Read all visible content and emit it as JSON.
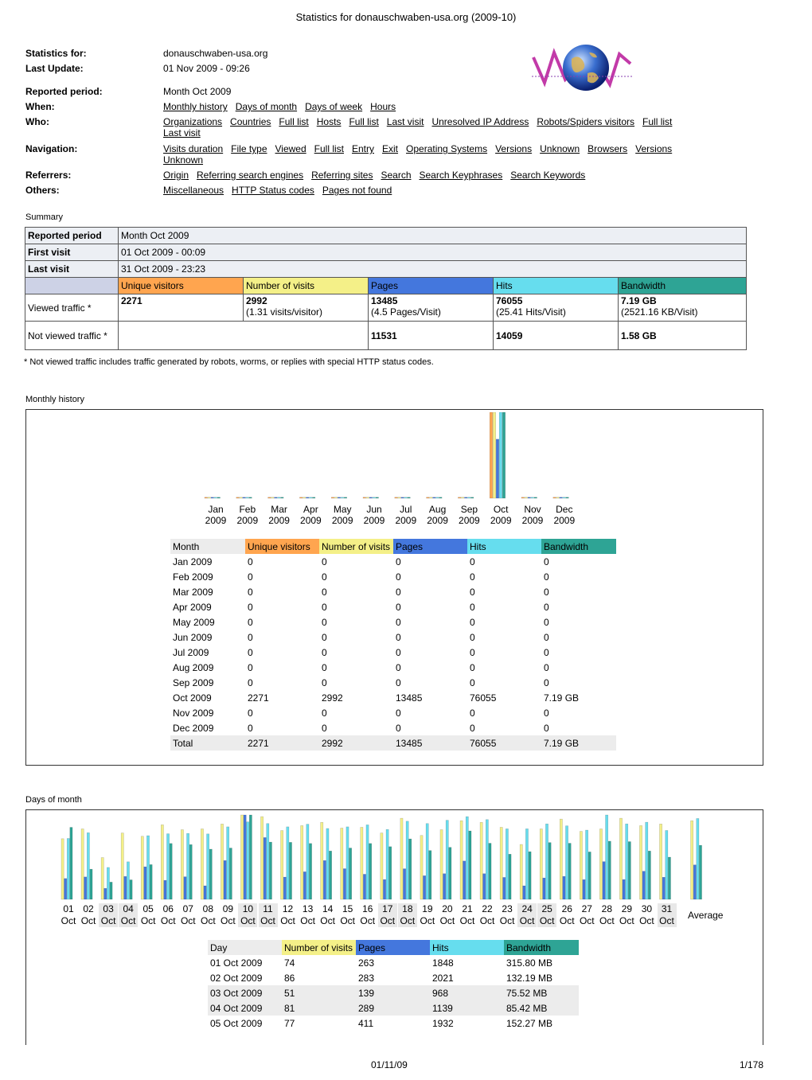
{
  "header": {
    "title": "Statistics for donauschwaben-usa.org (2009-10)"
  },
  "info": {
    "stats_for_label": "Statistics for:",
    "stats_for_value": "donauschwaben-usa.org",
    "last_update_label": "Last Update:",
    "last_update_value": "01 Nov 2009 - 09:26",
    "reported_label": "Reported period:",
    "reported_value": "Month Oct 2009",
    "when_label": "When:",
    "who_label": "Who:",
    "nav_label": "Navigation:",
    "ref_label": "Referrers:",
    "others_label": "Others:"
  },
  "links": {
    "when": [
      "Monthly history",
      "Days of month",
      "Days of week",
      "Hours"
    ],
    "who": [
      "Organizations",
      "Countries",
      "Full list",
      "Hosts",
      "Full list",
      "Last visit",
      "Unresolved IP Address",
      "Robots/Spiders visitors",
      "Full list",
      "Last visit"
    ],
    "nav": [
      "Visits duration",
      "File type",
      "Viewed",
      "Full list",
      "Entry",
      "Exit",
      "Operating Systems",
      "Versions",
      "Unknown",
      "Browsers",
      "Versions",
      "Unknown"
    ],
    "ref": [
      "Origin",
      "Referring search engines",
      "Referring sites",
      "Search",
      "Search Keyphrases",
      "Search Keywords"
    ],
    "others": [
      "Miscellaneous",
      "HTTP Status codes",
      "Pages not found"
    ]
  },
  "summary": {
    "section": "Summary",
    "reported_period_label": "Reported period",
    "reported_period_value": "Month Oct 2009",
    "first_visit_label": "First visit",
    "first_visit_value": "01 Oct 2009 - 00:09",
    "last_visit_label": "Last visit",
    "last_visit_value": "31 Oct 2009 - 23:23",
    "col_uv": "Unique visitors",
    "col_nv": "Number of visits",
    "col_pg": "Pages",
    "col_ht": "Hits",
    "col_bw": "Bandwidth",
    "viewed_label": "Viewed traffic *",
    "v_uv": "2271",
    "v_nv": "2992",
    "v_nv_sub": "(1.31 visits/visitor)",
    "v_pg": "13485",
    "v_pg_sub": "(4.5 Pages/Visit)",
    "v_ht": "76055",
    "v_ht_sub": "(25.41 Hits/Visit)",
    "v_bw": "7.19 GB",
    "v_bw_sub": "(2521.16 KB/Visit)",
    "not_viewed_label": "Not viewed traffic *",
    "nv_pg": "11531",
    "nv_ht": "14059",
    "nv_bw": "1.58 GB",
    "note": "* Not viewed traffic includes traffic generated by robots, worms, or replies with special HTTP status codes."
  },
  "colors": {
    "uv": "#ffa54f",
    "nv": "#f4f088",
    "pg": "#4477dd",
    "ht": "#66ddee",
    "bw": "#2ea495"
  },
  "monthly": {
    "section": "Monthly history",
    "headers": [
      "Month",
      "Unique visitors",
      "Number of visits",
      "Pages",
      "Hits",
      "Bandwidth"
    ],
    "rows": [
      [
        "Jan 2009",
        "0",
        "0",
        "0",
        "0",
        "0"
      ],
      [
        "Feb 2009",
        "0",
        "0",
        "0",
        "0",
        "0"
      ],
      [
        "Mar 2009",
        "0",
        "0",
        "0",
        "0",
        "0"
      ],
      [
        "Apr 2009",
        "0",
        "0",
        "0",
        "0",
        "0"
      ],
      [
        "May 2009",
        "0",
        "0",
        "0",
        "0",
        "0"
      ],
      [
        "Jun 2009",
        "0",
        "0",
        "0",
        "0",
        "0"
      ],
      [
        "Jul 2009",
        "0",
        "0",
        "0",
        "0",
        "0"
      ],
      [
        "Aug 2009",
        "0",
        "0",
        "0",
        "0",
        "0"
      ],
      [
        "Sep 2009",
        "0",
        "0",
        "0",
        "0",
        "0"
      ],
      [
        "Oct 2009",
        "2271",
        "2992",
        "13485",
        "76055",
        "7.19 GB"
      ],
      [
        "Nov 2009",
        "0",
        "0",
        "0",
        "0",
        "0"
      ],
      [
        "Dec 2009",
        "0",
        "0",
        "0",
        "0",
        "0"
      ]
    ],
    "total": [
      "Total",
      "2271",
      "2992",
      "13485",
      "76055",
      "7.19 GB"
    ],
    "axis_months": [
      "Jan",
      "Feb",
      "Mar",
      "Apr",
      "May",
      "Jun",
      "Jul",
      "Aug",
      "Sep",
      "Oct",
      "Nov",
      "Dec"
    ],
    "axis_year": "2009"
  },
  "chart_data": [
    {
      "type": "bar",
      "categories": [
        "Jan 2009",
        "Feb 2009",
        "Mar 2009",
        "Apr 2009",
        "May 2009",
        "Jun 2009",
        "Jul 2009",
        "Aug 2009",
        "Sep 2009",
        "Oct 2009",
        "Nov 2009",
        "Dec 2009"
      ],
      "series": [
        {
          "name": "Unique visitors",
          "values": [
            0,
            0,
            0,
            0,
            0,
            0,
            0,
            0,
            0,
            2271,
            0,
            0
          ]
        },
        {
          "name": "Number of visits",
          "values": [
            0,
            0,
            0,
            0,
            0,
            0,
            0,
            0,
            0,
            2992,
            0,
            0
          ]
        },
        {
          "name": "Pages",
          "values": [
            0,
            0,
            0,
            0,
            0,
            0,
            0,
            0,
            0,
            13485,
            0,
            0
          ]
        },
        {
          "name": "Hits",
          "values": [
            0,
            0,
            0,
            0,
            0,
            0,
            0,
            0,
            0,
            76055,
            0,
            0
          ]
        },
        {
          "name": "Bandwidth",
          "values": [
            0,
            0,
            0,
            0,
            0,
            0,
            0,
            0,
            0,
            7.19,
            0,
            0
          ]
        }
      ]
    },
    {
      "type": "bar",
      "categories": [
        "01",
        "02",
        "03",
        "04",
        "05",
        "06",
        "07",
        "08",
        "09",
        "10",
        "11",
        "12",
        "13",
        "14",
        "15",
        "16",
        "17",
        "18",
        "19",
        "20",
        "21",
        "22",
        "23",
        "24",
        "25",
        "26",
        "27",
        "28",
        "29",
        "30",
        "31",
        "Average"
      ],
      "series": [
        {
          "name": "Number of visits",
          "values": [
            74,
            86,
            51,
            81,
            77,
            91,
            85,
            86,
            92,
            103,
            101,
            84,
            90,
            94,
            87,
            88,
            81,
            99,
            78,
            85,
            96,
            94,
            88,
            67,
            86,
            98,
            83,
            86,
            99,
            90,
            92,
            96
          ]
        },
        {
          "name": "Pages",
          "values": [
            263,
            283,
            139,
            289,
            411,
            240,
            285,
            171,
            490,
            1065,
            780,
            281,
            348,
            490,
            387,
            317,
            250,
            386,
            298,
            324,
            484,
            324,
            277,
            171,
            270,
            290,
            249,
            476,
            250,
            355,
            279,
            435
          ]
        },
        {
          "name": "Hits",
          "values": [
            1848,
            2021,
            968,
            1139,
            1932,
            1990,
            2000,
            1985,
            2200,
            2350,
            2300,
            2200,
            2280,
            2150,
            2200,
            2260,
            2120,
            2370,
            2300,
            2400,
            2510,
            2420,
            2140,
            2140,
            2290,
            2230,
            2100,
            2560,
            2290,
            2340,
            2090,
            2453
          ]
        },
        {
          "name": "Bandwidth",
          "values": [
            315.8,
            132.19,
            75.52,
            85.45,
            152.27,
            245,
            240,
            220,
            225,
            370,
            251,
            250,
            245,
            212,
            225,
            245,
            231,
            265,
            214,
            228,
            300,
            246,
            198,
            209,
            249,
            246,
            208,
            255,
            253,
            212,
            185,
            237
          ]
        }
      ]
    }
  ],
  "days": {
    "section": "Days of month",
    "labels": [
      "01",
      "02",
      "03",
      "04",
      "05",
      "06",
      "07",
      "08",
      "09",
      "10",
      "11",
      "12",
      "13",
      "14",
      "15",
      "16",
      "17",
      "18",
      "19",
      "20",
      "21",
      "22",
      "23",
      "24",
      "25",
      "26",
      "27",
      "28",
      "29",
      "30",
      "31"
    ],
    "weekend": [
      3,
      4,
      10,
      11,
      17,
      18,
      24,
      25,
      31
    ],
    "month_word": "Oct",
    "average_label": "Average",
    "headers": [
      "Day",
      "Number of visits",
      "Pages",
      "Hits",
      "Bandwidth"
    ],
    "rows": [
      [
        "01 Oct 2009",
        "74",
        "263",
        "1848",
        "315.80 MB"
      ],
      [
        "02 Oct 2009",
        "86",
        "283",
        "2021",
        "132.19 MB"
      ],
      [
        "03 Oct 2009",
        "51",
        "139",
        "968",
        "75.52 MB"
      ],
      [
        "04 Oct 2009",
        "81",
        "289",
        "1139",
        "85.42 MB"
      ],
      [
        "05 Oct 2009",
        "77",
        "411",
        "1932",
        "152.27 MB"
      ]
    ]
  },
  "footer": {
    "date": "01/11/09",
    "page": "1/178"
  }
}
